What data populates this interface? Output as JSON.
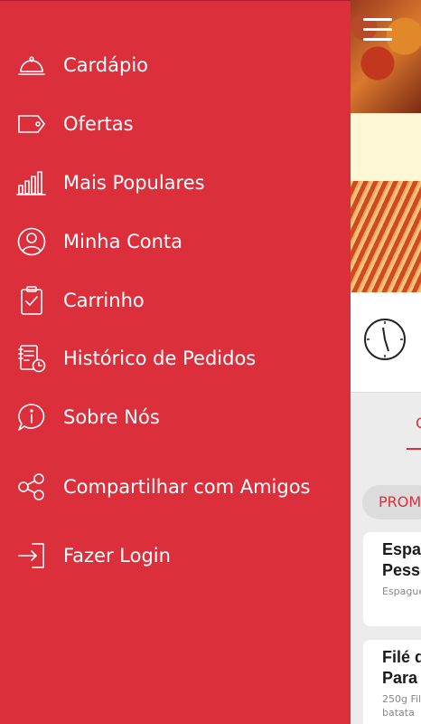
{
  "colors": {
    "accent": "#dc2f3c",
    "text_on_accent": "#ffffff"
  },
  "drawer": {
    "items": [
      {
        "label": "Cardápio",
        "icon": "cloche-icon"
      },
      {
        "label": "Ofertas",
        "icon": "tag-icon"
      },
      {
        "label": "Mais Populares",
        "icon": "bar-chart-icon"
      },
      {
        "label": "Minha Conta",
        "icon": "user-icon"
      },
      {
        "label": "Carrinho",
        "icon": "clipboard-check-icon"
      },
      {
        "label": "Histórico de Pedidos",
        "icon": "order-history-icon"
      },
      {
        "label": "Sobre Nós",
        "icon": "info-bubble-icon"
      },
      {
        "label": "Compartilhar com Amigos",
        "icon": "share-icon"
      },
      {
        "label": "Fazer Login",
        "icon": "login-icon"
      }
    ]
  },
  "background": {
    "tab_partial": "O",
    "promo_chip": "PROMO",
    "cards": [
      {
        "title_line1": "Espag",
        "title_line2": "Pesso",
        "subtitle": "Espaguete"
      },
      {
        "title_line1": "Filé d",
        "title_line2": "Para",
        "subtitle_line1": "250g Fil",
        "subtitle_line2": "batata"
      }
    ]
  }
}
